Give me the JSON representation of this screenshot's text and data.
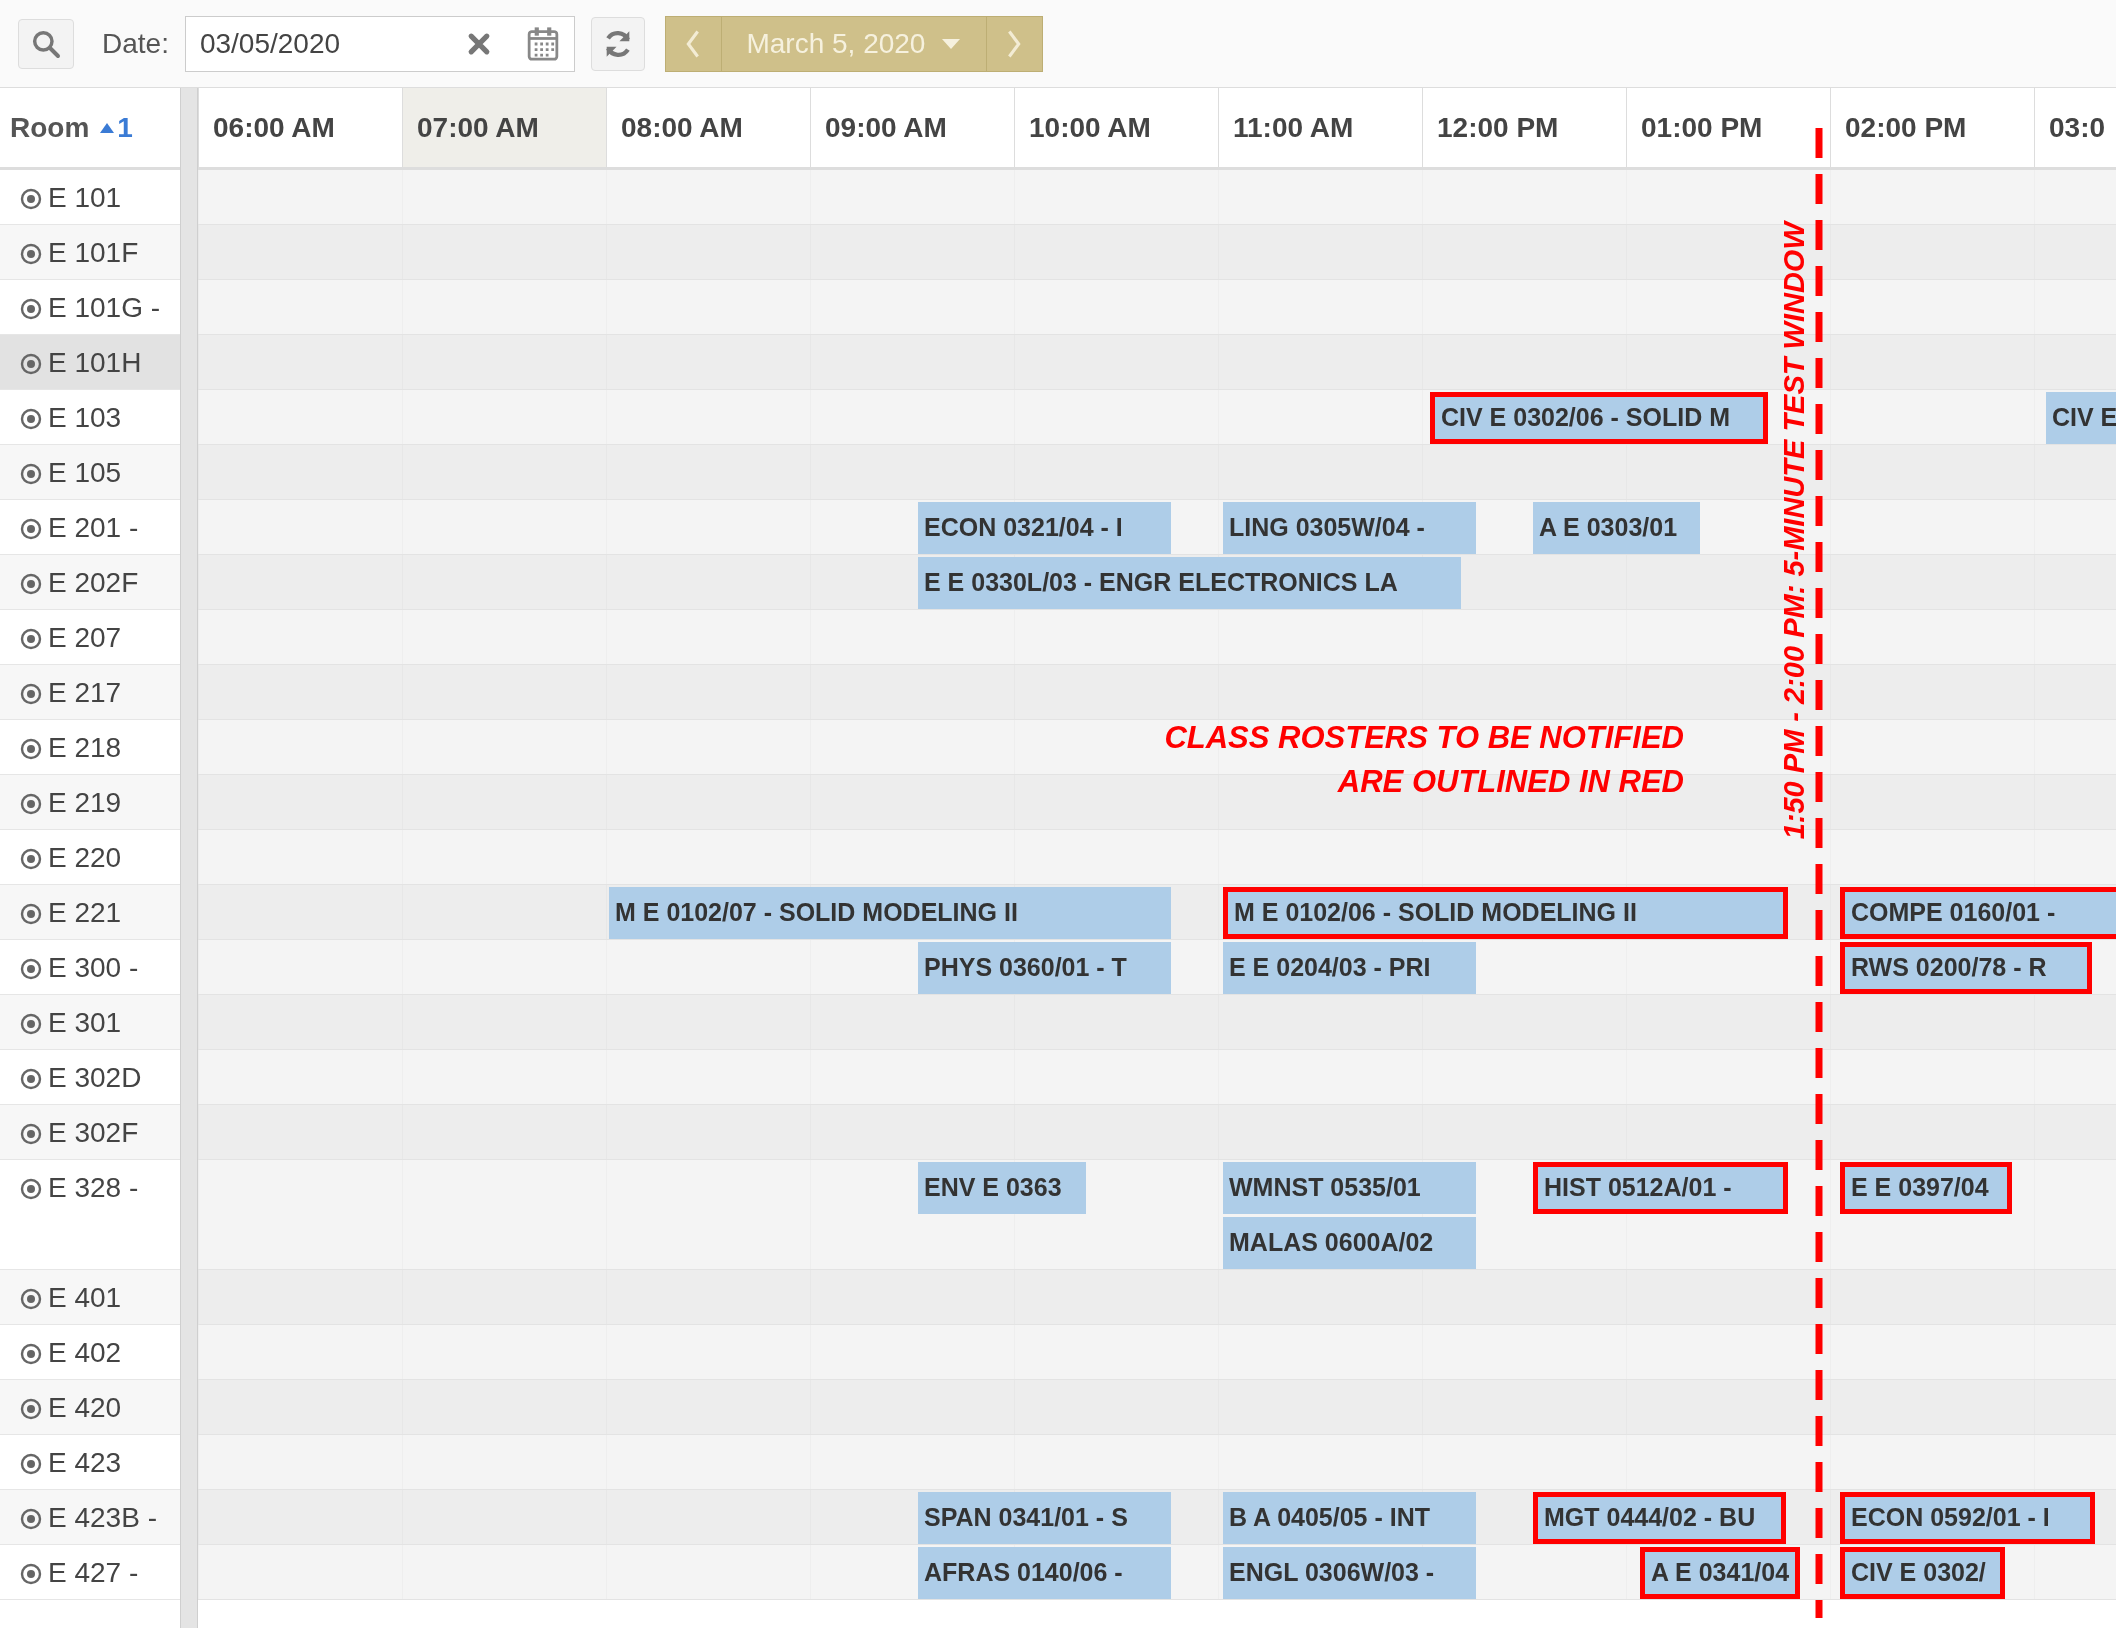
{
  "toolbar": {
    "date_label": "Date:",
    "date_value": "03/05/2020",
    "nav_label": "March 5, 2020"
  },
  "header": {
    "room_label": "Room",
    "sort_order": "1",
    "hours": [
      {
        "label": "06:00 AM",
        "selected": false
      },
      {
        "label": "07:00 AM",
        "selected": true
      },
      {
        "label": "08:00 AM",
        "selected": false
      },
      {
        "label": "09:00 AM",
        "selected": false
      },
      {
        "label": "10:00 AM",
        "selected": false
      },
      {
        "label": "11:00 AM",
        "selected": false
      },
      {
        "label": "12:00 PM",
        "selected": false
      },
      {
        "label": "01:00 PM",
        "selected": false
      },
      {
        "label": "02:00 PM",
        "selected": false
      },
      {
        "label": "03:0",
        "selected": false
      }
    ]
  },
  "rooms": [
    {
      "name": "E 101",
      "selected": false
    },
    {
      "name": "E 101F",
      "selected": false
    },
    {
      "name": "E 101G -",
      "selected": false
    },
    {
      "name": "E 101H",
      "selected": true
    },
    {
      "name": "E 103",
      "selected": false,
      "events": [
        {
          "label": "CIV E 0302/06 - SOLID M",
          "flagged": true
        },
        {
          "label": "CIV E",
          "flagged": false
        }
      ]
    },
    {
      "name": "E 105",
      "selected": false
    },
    {
      "name": "E 201 -",
      "selected": false,
      "events": [
        {
          "label": "ECON 0321/04 - I",
          "flagged": false
        },
        {
          "label": "LING 0305W/04 -",
          "flagged": false
        },
        {
          "label": "A E 0303/01",
          "flagged": false
        }
      ]
    },
    {
      "name": "E 202F",
      "selected": false,
      "events": [
        {
          "label": "E E 0330L/03 - ENGR ELECTRONICS LA",
          "flagged": false
        }
      ]
    },
    {
      "name": "E 207",
      "selected": false
    },
    {
      "name": "E 217",
      "selected": false
    },
    {
      "name": "E 218",
      "selected": false
    },
    {
      "name": "E 219",
      "selected": false
    },
    {
      "name": "E 220",
      "selected": false
    },
    {
      "name": "E 221",
      "selected": false,
      "events": [
        {
          "label": "M E 0102/07 - SOLID MODELING II",
          "flagged": false
        },
        {
          "label": "M E 0102/06 - SOLID MODELING II",
          "flagged": true
        },
        {
          "label": "COMPE 0160/01 -",
          "flagged": true
        }
      ]
    },
    {
      "name": "E 300 -",
      "selected": false,
      "events": [
        {
          "label": "PHYS 0360/01 - T",
          "flagged": false
        },
        {
          "label": "E E 0204/03 - PRI",
          "flagged": false
        },
        {
          "label": "RWS 0200/78 - R",
          "flagged": true
        }
      ]
    },
    {
      "name": "E 301",
      "selected": false
    },
    {
      "name": "E 302D",
      "selected": false
    },
    {
      "name": "E 302F",
      "selected": false
    },
    {
      "name": "E 328 -",
      "selected": false,
      "events": [
        {
          "label": "ENV E 0363",
          "flagged": false
        },
        {
          "label": "WMNST 0535/01",
          "flagged": false
        },
        {
          "label": "MALAS 0600A/02",
          "flagged": false
        },
        {
          "label": "HIST 0512A/01 -",
          "flagged": true
        },
        {
          "label": "E E 0397/04",
          "flagged": true
        }
      ]
    },
    {
      "name": "E 401",
      "selected": false
    },
    {
      "name": "E 402",
      "selected": false
    },
    {
      "name": "E 420",
      "selected": false
    },
    {
      "name": "E 423",
      "selected": false
    },
    {
      "name": "E 423B -",
      "selected": false,
      "events": [
        {
          "label": "SPAN 0341/01 - S",
          "flagged": false
        },
        {
          "label": "B A 0405/05 - INT",
          "flagged": false
        },
        {
          "label": "MGT 0444/02 - BU",
          "flagged": true
        },
        {
          "label": "ECON 0592/01 - I",
          "flagged": true
        }
      ]
    },
    {
      "name": "E 427 -",
      "selected": false,
      "events": [
        {
          "label": "AFRAS 0140/06 -",
          "flagged": false
        },
        {
          "label": "ENGL 0306W/03 -",
          "flagged": false
        },
        {
          "label": "A E 0341/04",
          "flagged": true
        },
        {
          "label": "CIV E 0302/",
          "flagged": true
        }
      ]
    }
  ],
  "annotations": {
    "note_lines": [
      "CLASS ROSTERS TO BE NOTIFIED",
      "ARE OUTLINED IN RED"
    ],
    "test_window": "1:50 PM - 2:00 PM: 5-MINUTE TEST WINDOW"
  }
}
